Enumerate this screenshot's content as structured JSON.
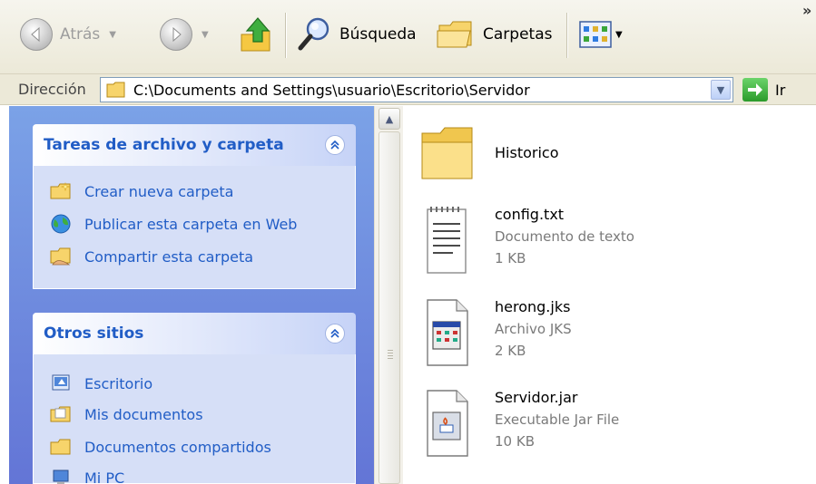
{
  "toolbar": {
    "back_label": "Atrás",
    "search_label": "Búsqueda",
    "folders_label": "Carpetas",
    "chevron": "»"
  },
  "addressbar": {
    "label": "Dirección",
    "path": "C:\\Documents and Settings\\usuario\\Escritorio\\Servidor",
    "go_label": "Ir"
  },
  "taskpane": {
    "file_tasks": {
      "title": "Tareas de archivo y carpeta",
      "items": [
        {
          "label": "Crear nueva carpeta",
          "icon": "new-folder-icon"
        },
        {
          "label": "Publicar esta carpeta en Web",
          "icon": "publish-web-icon"
        },
        {
          "label": "Compartir esta carpeta",
          "icon": "share-folder-icon"
        }
      ]
    },
    "other_places": {
      "title": "Otros sitios",
      "items": [
        {
          "label": "Escritorio",
          "icon": "desktop-icon"
        },
        {
          "label": "Mis documentos",
          "icon": "my-documents-icon"
        },
        {
          "label": "Documentos compartidos",
          "icon": "shared-documents-icon"
        },
        {
          "label": "Mi PC",
          "icon": "my-computer-icon"
        }
      ]
    }
  },
  "files": [
    {
      "name": "Historico",
      "type": "",
      "size": "",
      "icon": "folder-icon"
    },
    {
      "name": "config.txt",
      "type": "Documento de texto",
      "size": "1 KB",
      "icon": "text-file-icon"
    },
    {
      "name": "herong.jks",
      "type": "Archivo JKS",
      "size": "2 KB",
      "icon": "jks-file-icon"
    },
    {
      "name": "Servidor.jar",
      "type": "Executable Jar File",
      "size": "10 KB",
      "icon": "jar-file-icon"
    }
  ],
  "colors": {
    "link_blue": "#215dc6",
    "pane_blue": "#6f8fe0",
    "folder_yellow": "#f7d46b"
  }
}
